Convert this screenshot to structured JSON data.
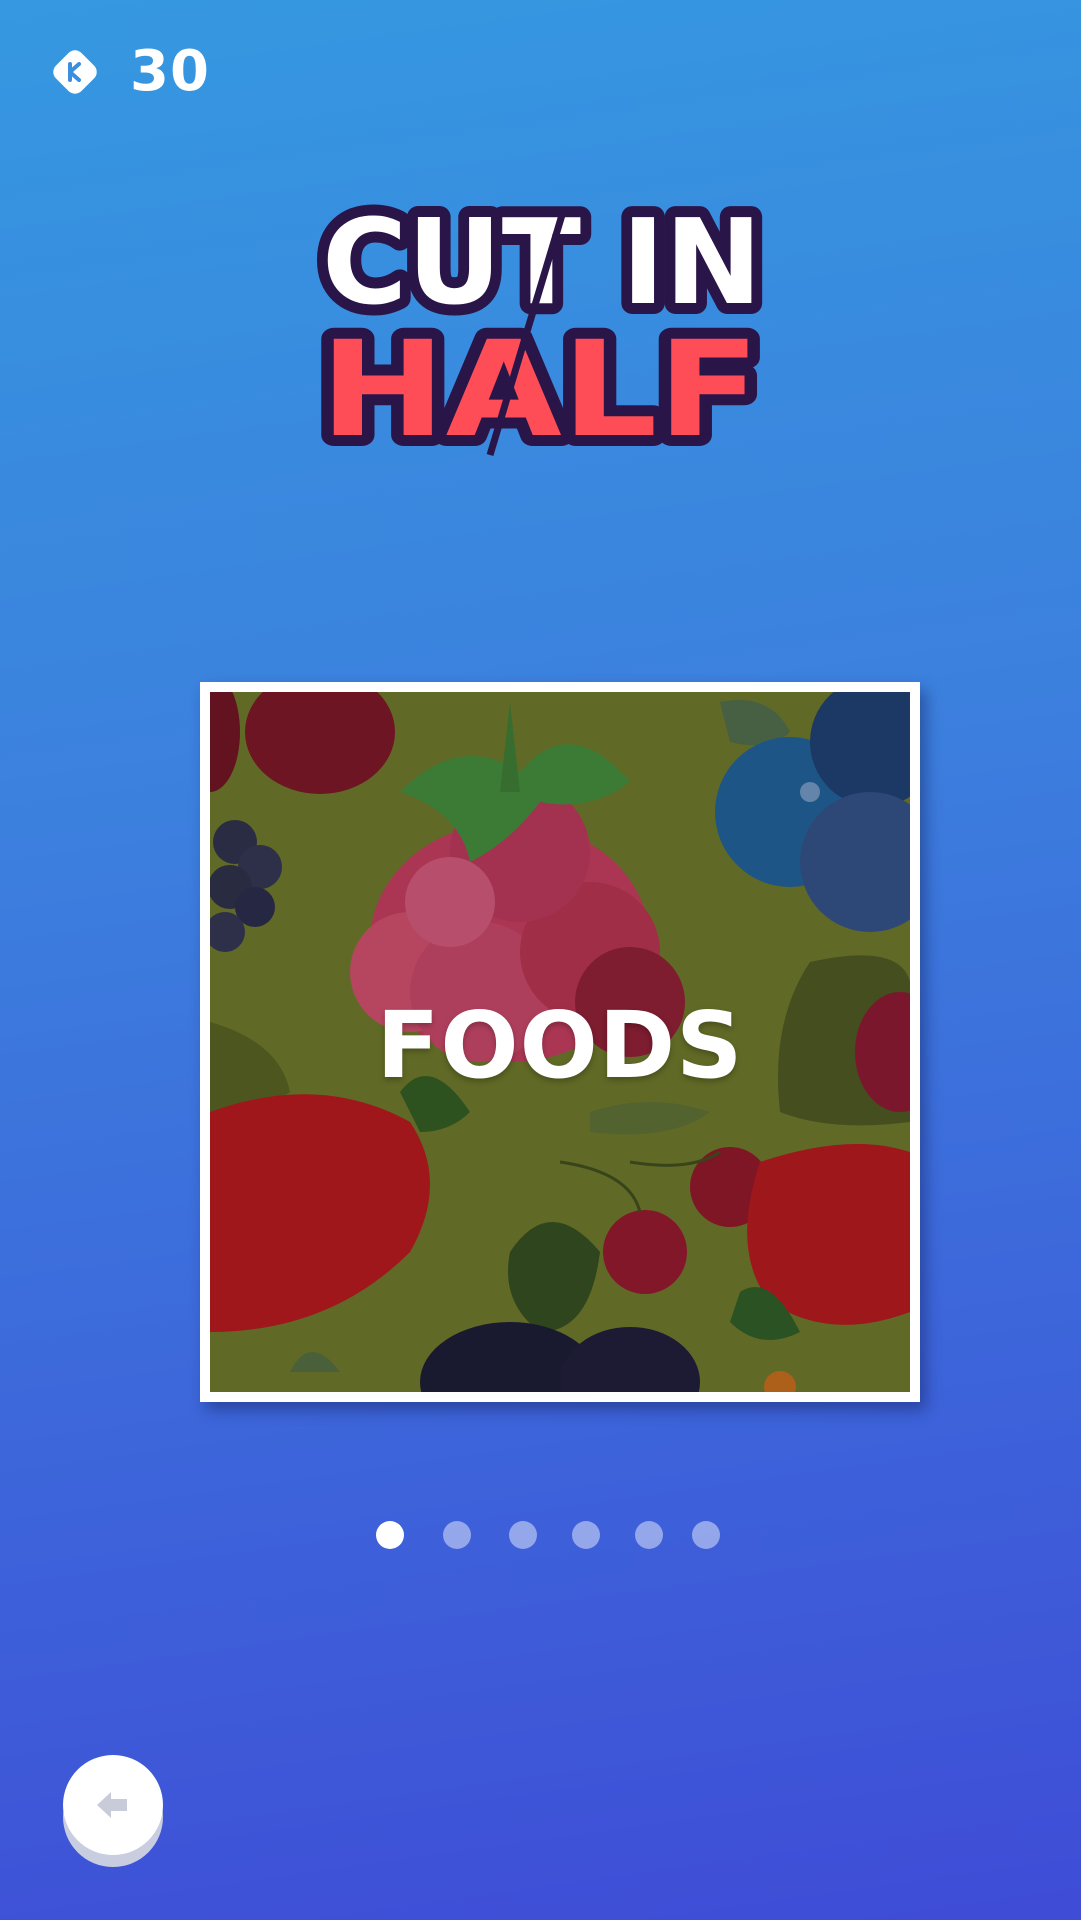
{
  "header": {
    "coin_count": "30",
    "coin_icon": "k-coin-icon"
  },
  "logo": {
    "line1": "CUT IN",
    "line2": "HALF",
    "colors": {
      "line1": "#ffffff",
      "line2": "#ff4d57",
      "outline": "#2a1548"
    }
  },
  "carousel": {
    "category_label": "FOODS",
    "background_art": "berries-pattern",
    "page_count": 6,
    "active_page": 1
  },
  "footer": {
    "back_icon": "arrow-left-icon"
  },
  "colors": {
    "background_top": "#3598e0",
    "background_bottom": "#3f4cd6",
    "card_border": "#ffffff",
    "dot_active": "#ffffff",
    "dot_inactive": "rgba(255,255,255,0.45)"
  }
}
